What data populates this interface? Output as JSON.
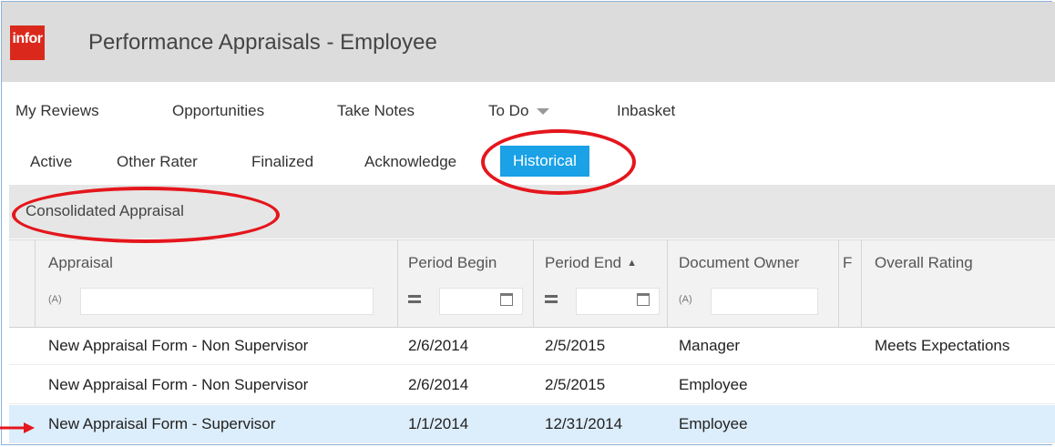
{
  "header": {
    "logo_text": "infor",
    "title": "Performance Appraisals - Employee"
  },
  "module_nav": {
    "items": [
      {
        "label": "My Reviews"
      },
      {
        "label": "Opportunities"
      },
      {
        "label": "Take Notes"
      },
      {
        "label": "To Do",
        "icon": "chevron-down-icon"
      },
      {
        "label": "Inbasket"
      }
    ]
  },
  "tabs": {
    "items": [
      {
        "label": "Active"
      },
      {
        "label": "Other Rater"
      },
      {
        "label": "Finalized"
      },
      {
        "label": "Acknowledge"
      },
      {
        "label": "Historical",
        "selected": true
      }
    ]
  },
  "toolbar": {
    "consolidated_label": "Consolidated Appraisal"
  },
  "grid": {
    "columns": [
      {
        "label": "Appraisal",
        "filter_icon": "text-filter-icon"
      },
      {
        "label": "Period Begin",
        "filter_icon": "equals-filter-icon"
      },
      {
        "label": "Period End",
        "sort": "asc",
        "sort_glyph": "▲",
        "filter_icon": "equals-filter-icon"
      },
      {
        "label": "Document Owner",
        "filter_icon": "text-filter-icon"
      },
      {
        "label": "F"
      },
      {
        "label": "Overall Rating"
      }
    ],
    "filter_text_glyph": "(A)",
    "rows": [
      {
        "appraisal": "New Appraisal Form - Non Supervisor",
        "period_begin": "2/6/2014",
        "period_end": "2/5/2015",
        "owner": "Manager",
        "overall_rating": "Meets Expectations",
        "selected": false
      },
      {
        "appraisal": "New Appraisal Form - Non Supervisor",
        "period_begin": "2/6/2014",
        "period_end": "2/5/2015",
        "owner": "Employee",
        "overall_rating": "",
        "selected": false
      },
      {
        "appraisal": "New Appraisal Form - Supervisor",
        "period_begin": "1/1/2014",
        "period_end": "12/31/2014",
        "owner": "Employee",
        "overall_rating": "",
        "selected": true
      }
    ]
  },
  "colors": {
    "brand_red": "#da291c",
    "active_tab": "#1aa1e6",
    "selected_row": "#dcedfb",
    "annotation_red": "#e4161c"
  }
}
